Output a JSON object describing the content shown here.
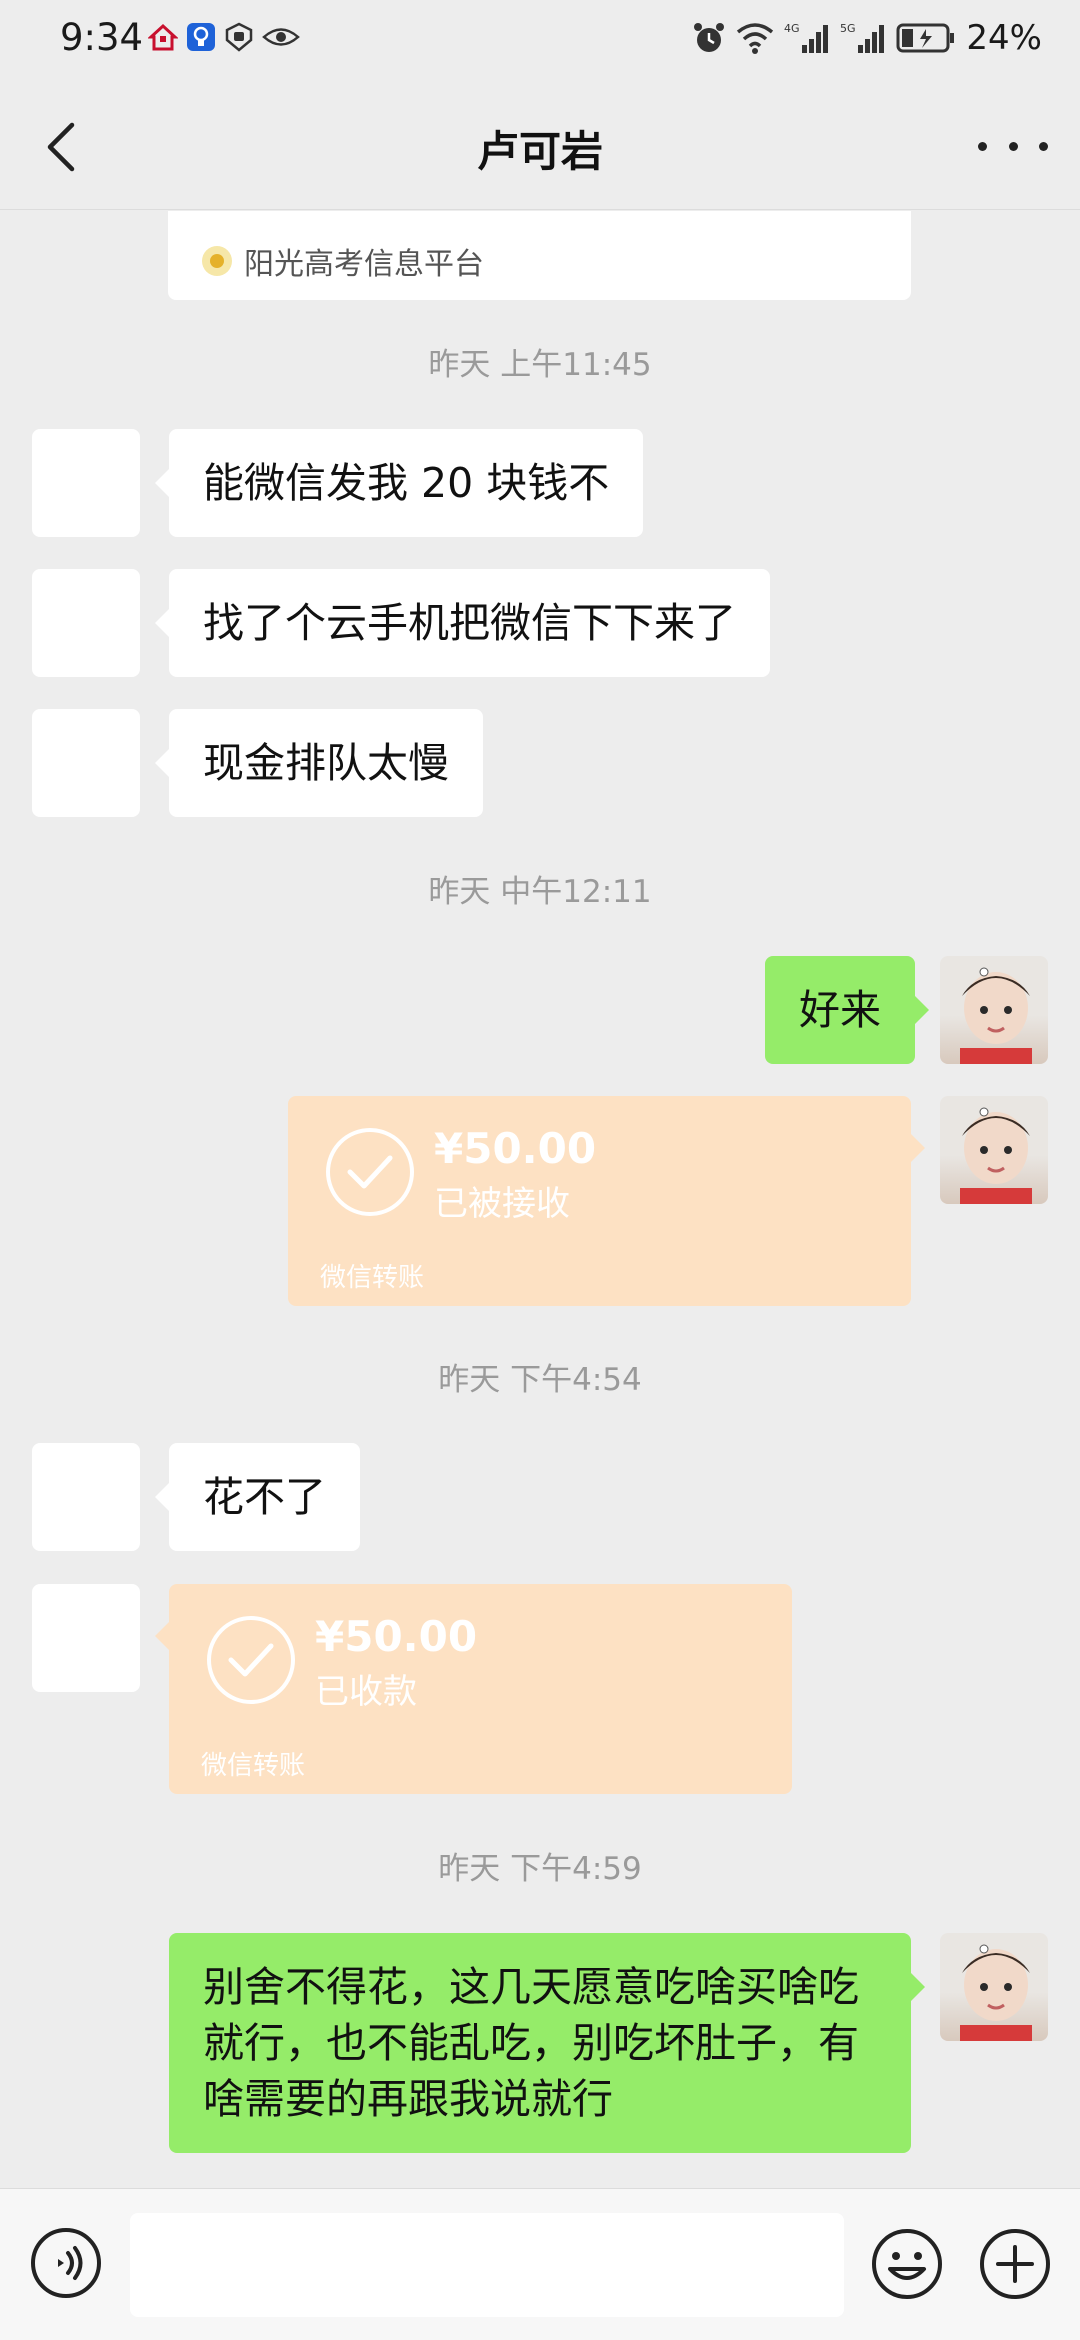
{
  "status_bar": {
    "time": "9:34",
    "battery": "24%",
    "network_1": "4G",
    "network_2": "5G"
  },
  "nav": {
    "title": "卢可岩"
  },
  "link_card": {
    "source": "阳光高考信息平台"
  },
  "messages": [
    {
      "type": "time",
      "text": "昨天 上午11:45"
    },
    {
      "type": "text",
      "side": "in",
      "text": "能微信发我 20 块钱不"
    },
    {
      "type": "text",
      "side": "in",
      "text": "找了个云手机把微信下下来了"
    },
    {
      "type": "text",
      "side": "in",
      "text": "现金排队太慢"
    },
    {
      "type": "time",
      "text": "昨天 中午12:11"
    },
    {
      "type": "text",
      "side": "out",
      "text": "好来"
    },
    {
      "type": "transfer",
      "side": "out",
      "amount": "¥50.00",
      "status": "已被接收",
      "footer": "微信转账"
    },
    {
      "type": "time",
      "text": "昨天 下午4:54"
    },
    {
      "type": "text",
      "side": "in",
      "text": "花不了"
    },
    {
      "type": "transfer",
      "side": "in",
      "amount": "¥50.00",
      "status": "已收款",
      "footer": "微信转账"
    },
    {
      "type": "time",
      "text": "昨天 下午4:59"
    },
    {
      "type": "text",
      "side": "out",
      "text": "别舍不得花，这几天愿意吃啥买啥吃就行，也不能乱吃，别吃坏肚子，有啥需要的再跟我说就行"
    }
  ],
  "input": {
    "placeholder": ""
  },
  "colors": {
    "background": "#ededed",
    "outgoing_bubble": "#95ec69",
    "incoming_bubble": "#ffffff",
    "transfer_card": "#fde1c3",
    "timestamp_text": "#9a9a9a"
  },
  "icons": {
    "back": "chevron-left-icon",
    "more": "more-dots-icon",
    "voice": "voice-icon",
    "emoji": "emoji-icon",
    "plus": "plus-icon",
    "transfer_check": "check-circle-icon"
  }
}
